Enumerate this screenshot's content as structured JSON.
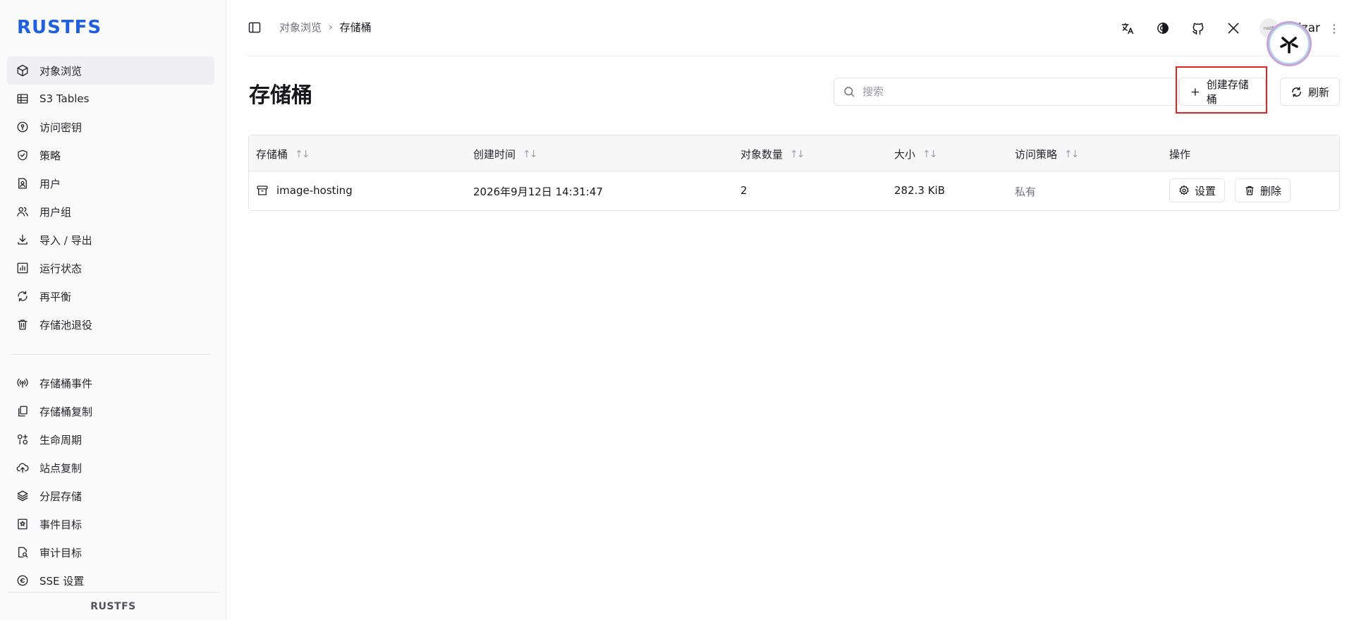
{
  "sidebar": {
    "logo": "RUSTFS",
    "items": [
      {
        "label": "对象浏览",
        "icon": "cube-icon",
        "active": true
      },
      {
        "label": "S3 Tables",
        "icon": "table-icon"
      },
      {
        "label": "访问密钥",
        "icon": "key-circle-icon"
      },
      {
        "label": "策略",
        "icon": "shield-check-icon"
      },
      {
        "label": "用户",
        "icon": "user-file-icon"
      },
      {
        "label": "用户组",
        "icon": "users-icon"
      },
      {
        "label": "导入 / 导出",
        "icon": "download-icon"
      },
      {
        "label": "运行状态",
        "icon": "chart-bar-icon"
      },
      {
        "label": "再平衡",
        "icon": "refresh-icon"
      },
      {
        "label": "存储池退役",
        "icon": "trash-icon"
      }
    ],
    "items2": [
      {
        "label": "存储桶事件",
        "icon": "broadcast-icon"
      },
      {
        "label": "存储桶复制",
        "icon": "copy-icon"
      },
      {
        "label": "生命周期",
        "icon": "lifecycle-icon"
      },
      {
        "label": "站点复制",
        "icon": "cloud-upload-icon"
      },
      {
        "label": "分层存储",
        "icon": "layers-icon"
      },
      {
        "label": "事件目标",
        "icon": "bookmark-icon"
      },
      {
        "label": "审计目标",
        "icon": "file-search-icon"
      },
      {
        "label": "SSE 设置",
        "icon": "encryption-icon"
      }
    ],
    "footer": "RUSTFS"
  },
  "topbar": {
    "breadcrumb": [
      "对象浏览",
      "存储桶"
    ],
    "username": "mizar",
    "avatar_text": "rustfs"
  },
  "main": {
    "title": "存储桶",
    "search_placeholder": "搜索",
    "create_label": "创建存储桶",
    "refresh_label": "刷新"
  },
  "table": {
    "columns": [
      "存储桶",
      "创建时间",
      "对象数量",
      "大小",
      "访问策略",
      "操作"
    ],
    "rows": [
      {
        "bucket": "image-hosting",
        "created": "2026年9月12日 14:31:47",
        "objects": "2",
        "size": "282.3 KiB",
        "policy": "私有",
        "settings_label": "设置",
        "delete_label": "删除"
      }
    ]
  },
  "colors": {
    "brand": "#1f5fe0",
    "highlight": "#e02424"
  }
}
